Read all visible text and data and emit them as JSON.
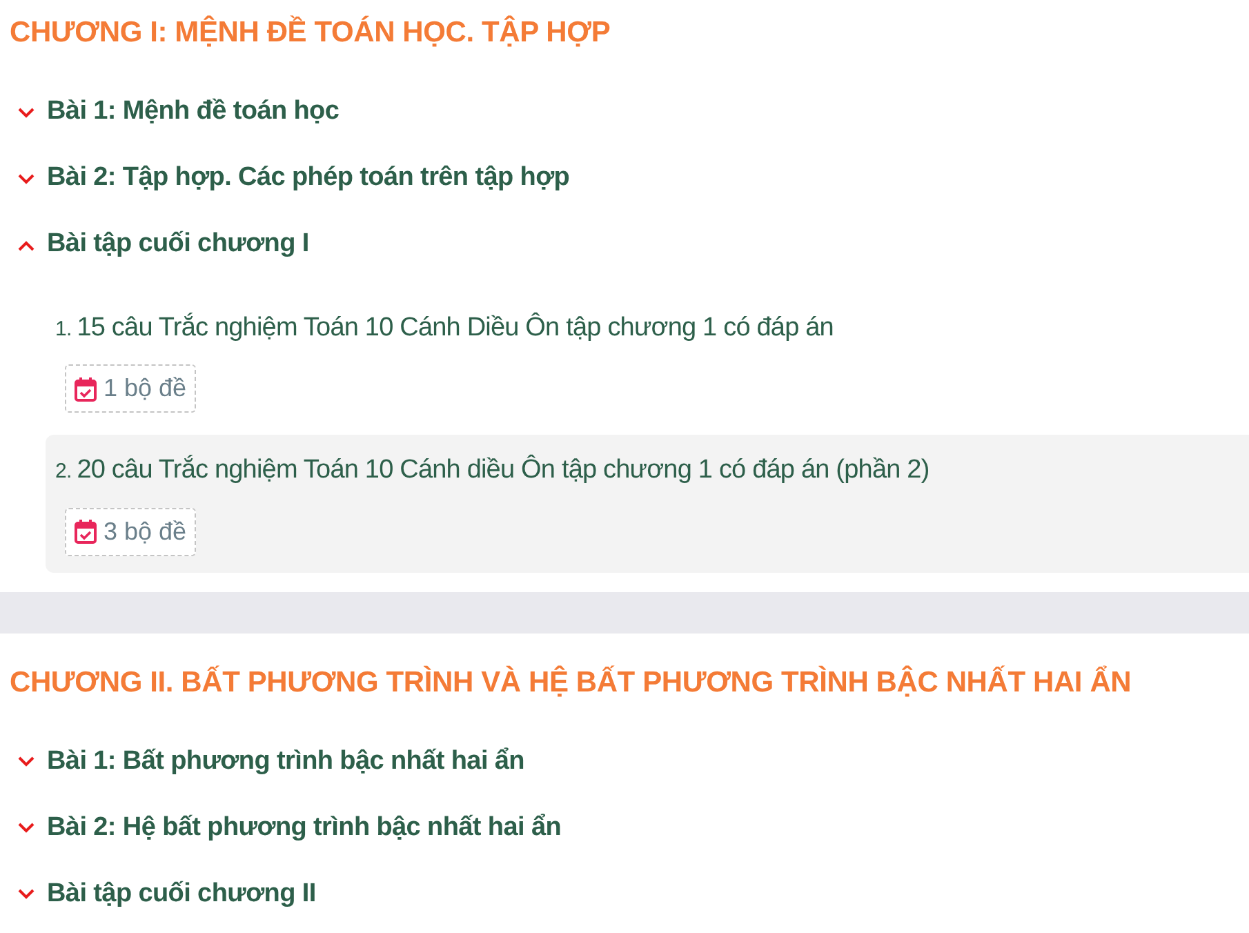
{
  "chapters": [
    {
      "title": "CHƯƠNG I: MỆNH ĐỀ TOÁN HỌC. TẬP HỢP",
      "lessons": [
        {
          "title": "Bài 1: Mệnh đề toán học",
          "expanded": false
        },
        {
          "title": "Bài 2: Tập hợp. Các phép toán trên tập hợp",
          "expanded": false
        },
        {
          "title": "Bài tập cuối chương I",
          "expanded": true,
          "items": [
            {
              "number": "1.",
              "title": "15 câu Trắc nghiệm Toán 10 Cánh Diều Ôn tập chương 1 có đáp án",
              "badge": "1 bộ đề",
              "highlighted": false
            },
            {
              "number": "2.",
              "title": "20 câu Trắc nghiệm Toán 10 Cánh diều Ôn tập chương 1 có đáp án (phần 2)",
              "badge": "3 bộ đề",
              "highlighted": true
            }
          ]
        }
      ]
    },
    {
      "title": "CHƯƠNG II. BẤT PHƯƠNG TRÌNH VÀ HỆ BẤT PHƯƠNG TRÌNH BẬC NHẤT HAI ẨN",
      "lessons": [
        {
          "title": "Bài 1: Bất phương trình bậc nhất hai ẩn",
          "expanded": false
        },
        {
          "title": "Bài 2: Hệ bất phương trình bậc nhất hai ẩn",
          "expanded": false
        },
        {
          "title": "Bài tập cuối chương II",
          "expanded": false
        }
      ]
    }
  ]
}
